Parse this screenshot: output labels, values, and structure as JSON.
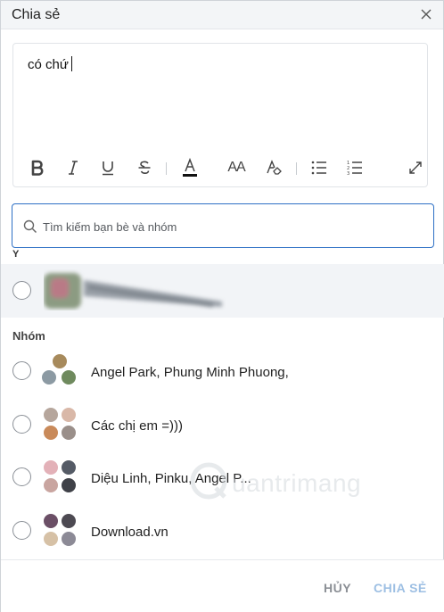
{
  "title": "Chia sẻ",
  "editor": {
    "text": "có chứ"
  },
  "toolbar": {
    "items": [
      "bold",
      "italic",
      "underline",
      "strikethrough",
      "font-color",
      "font-size",
      "clear-format",
      "bullet-list",
      "numbered-list",
      "expand"
    ],
    "font_size_label": "AA"
  },
  "search": {
    "placeholder": "Tìm kiếm bạn bè và nhóm"
  },
  "sections": {
    "recent_label": "Y",
    "groups_label": "Nhóm"
  },
  "groups": [
    {
      "name": "Angel Park, Phung Minh Phuong,"
    },
    {
      "name": "Các chị em =)))"
    },
    {
      "name": "Diệu Linh, Pinku, Angel P..."
    },
    {
      "name": "Download.vn"
    }
  ],
  "footer": {
    "cancel_label": "HỦY",
    "share_label": "CHIA SẺ"
  },
  "watermark": {
    "text": "uantrimang"
  },
  "colors": {
    "accent": "#2d6fc5",
    "share_disabled": "#9dbfe3",
    "font_color_bar": "#111111"
  }
}
